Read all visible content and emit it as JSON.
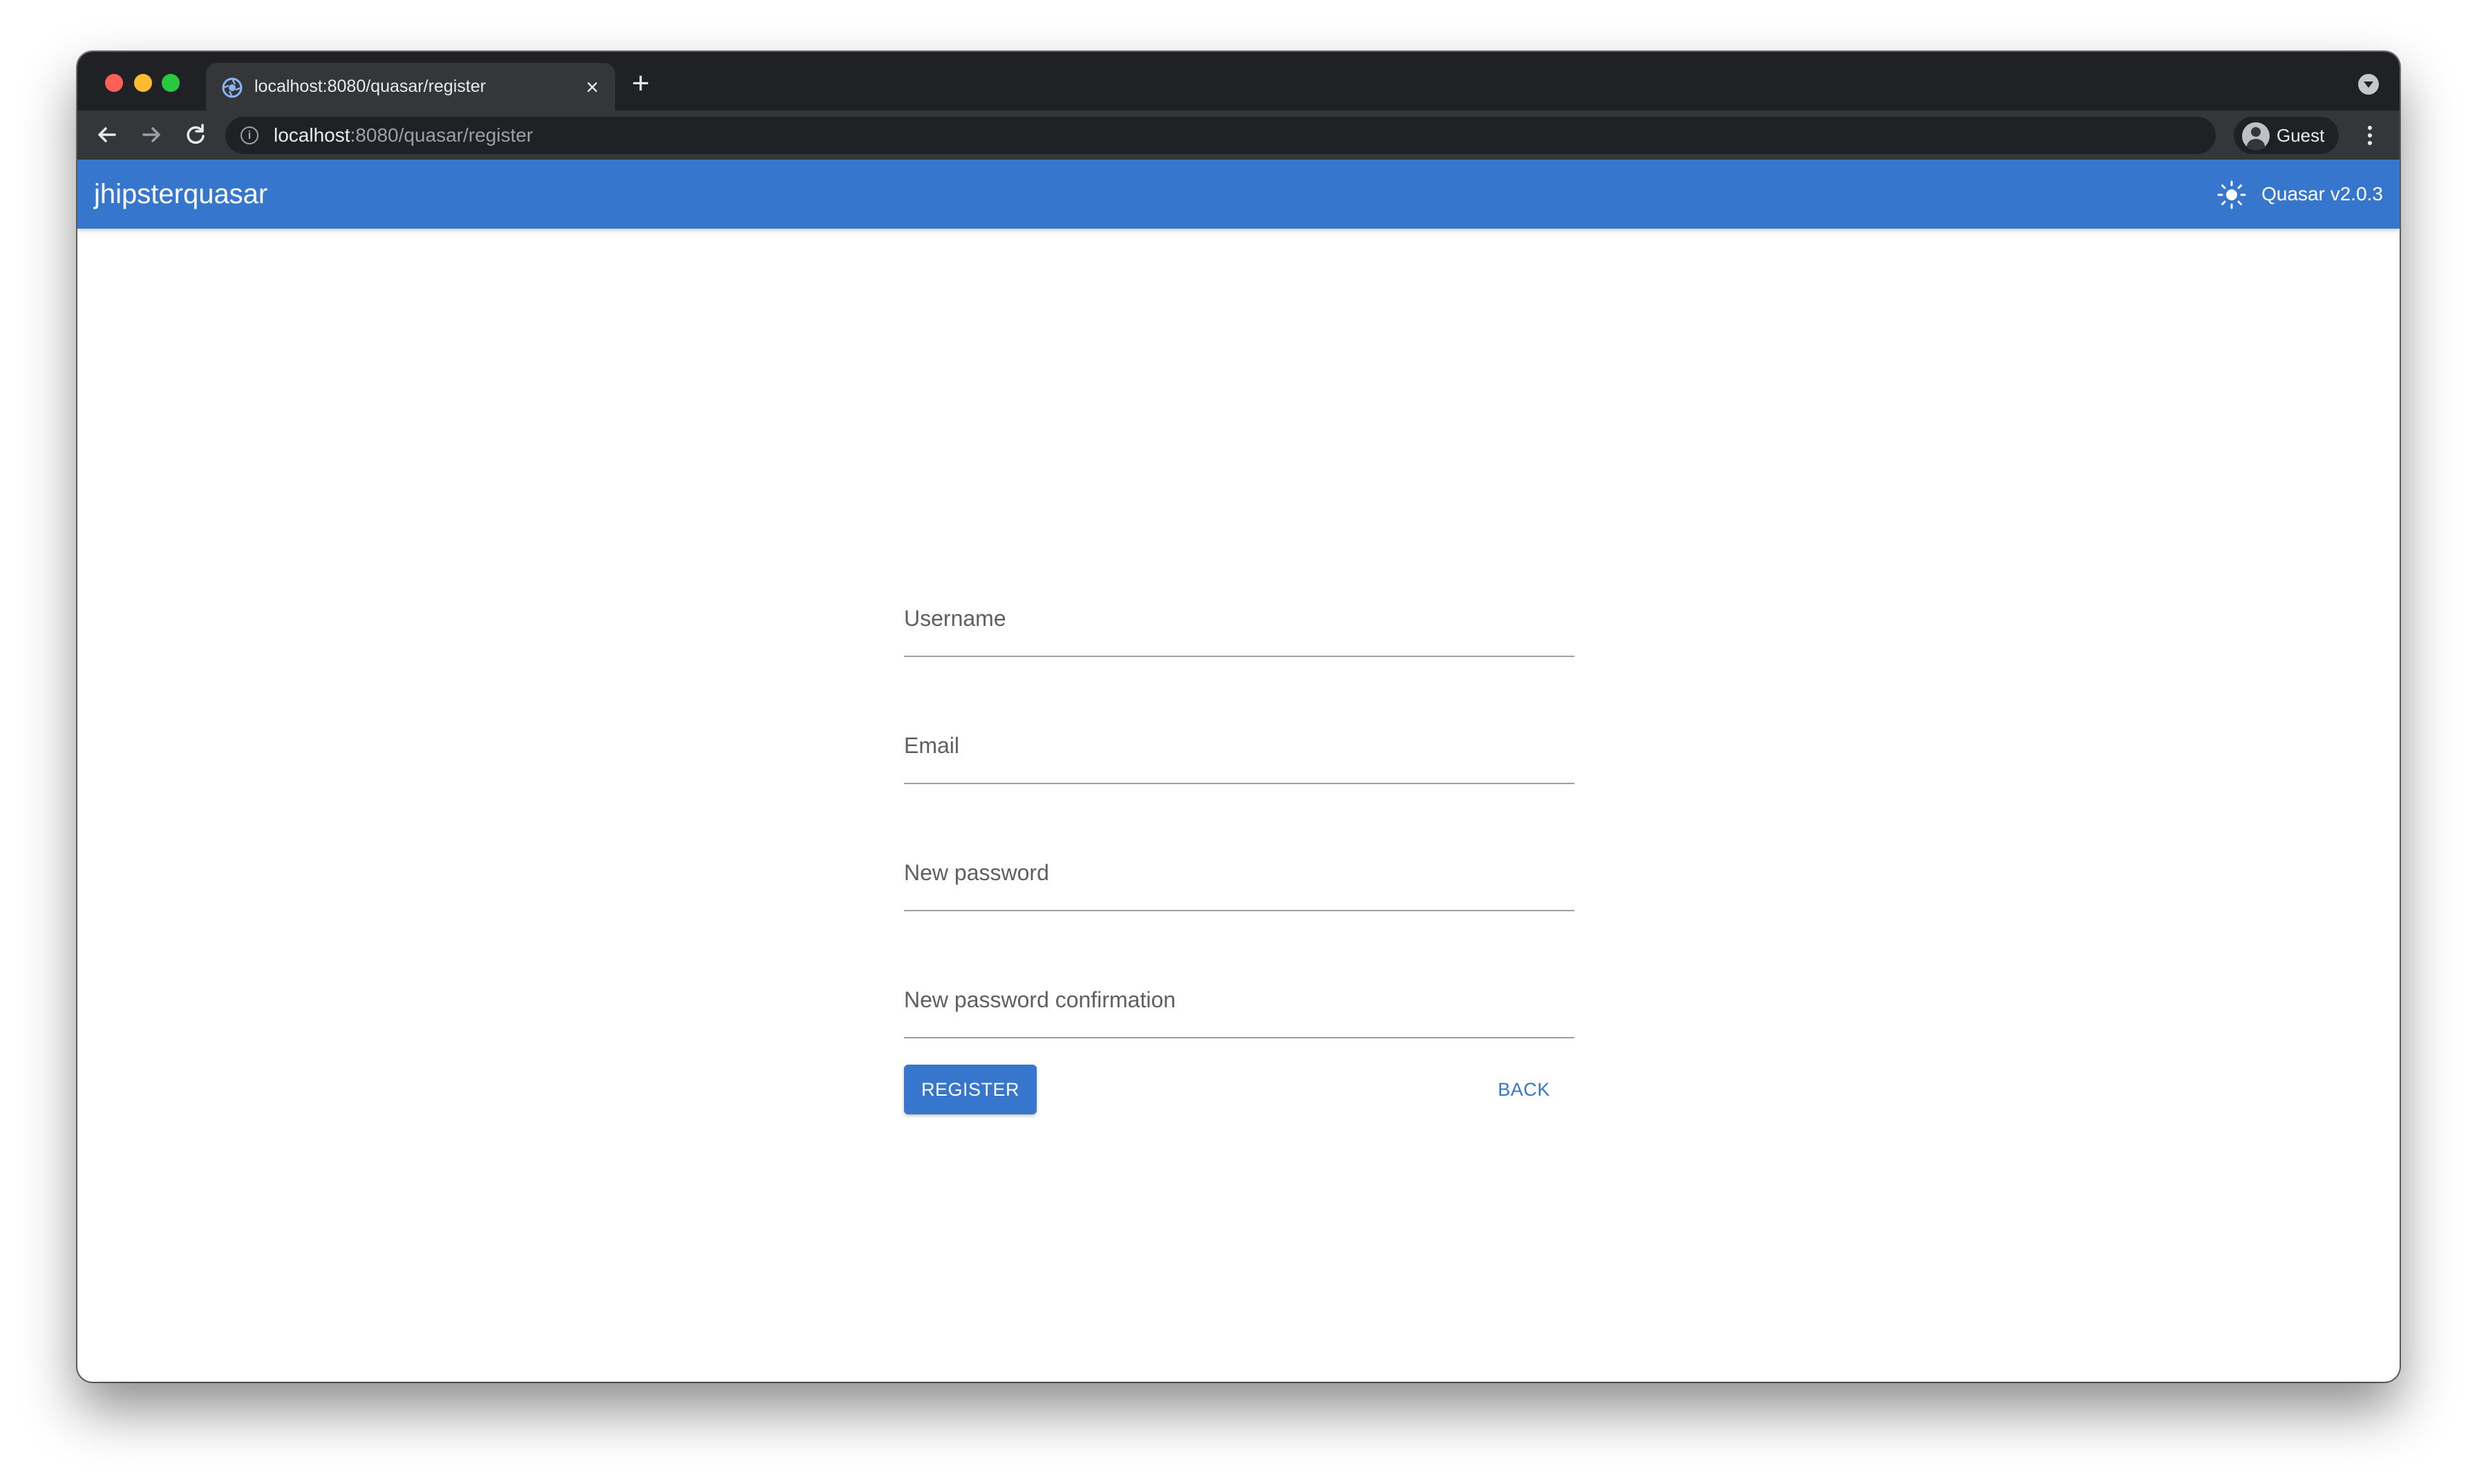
{
  "browser": {
    "tab": {
      "title": "localhost:8080/quasar/register",
      "favicon": "quasar-logo-icon"
    },
    "address_bar": {
      "host": "localhost",
      "path": ":8080/quasar/register"
    },
    "profile": {
      "label": "Guest"
    }
  },
  "app": {
    "title": "jhipsterquasar",
    "version": "Quasar v2.0.3",
    "accent_color": "#3776cd"
  },
  "form": {
    "fields": [
      {
        "label": "Username",
        "value": ""
      },
      {
        "label": "Email",
        "value": ""
      },
      {
        "label": "New password",
        "value": ""
      },
      {
        "label": "New password confirmation",
        "value": ""
      }
    ],
    "register_label": "REGISTER",
    "back_label": "BACK"
  },
  "icons": {
    "back": "arrow-left-icon",
    "forward": "arrow-right-icon",
    "reload": "reload-icon",
    "info": "info-icon",
    "theme": "sun-icon",
    "menu": "kebab-menu-icon"
  }
}
